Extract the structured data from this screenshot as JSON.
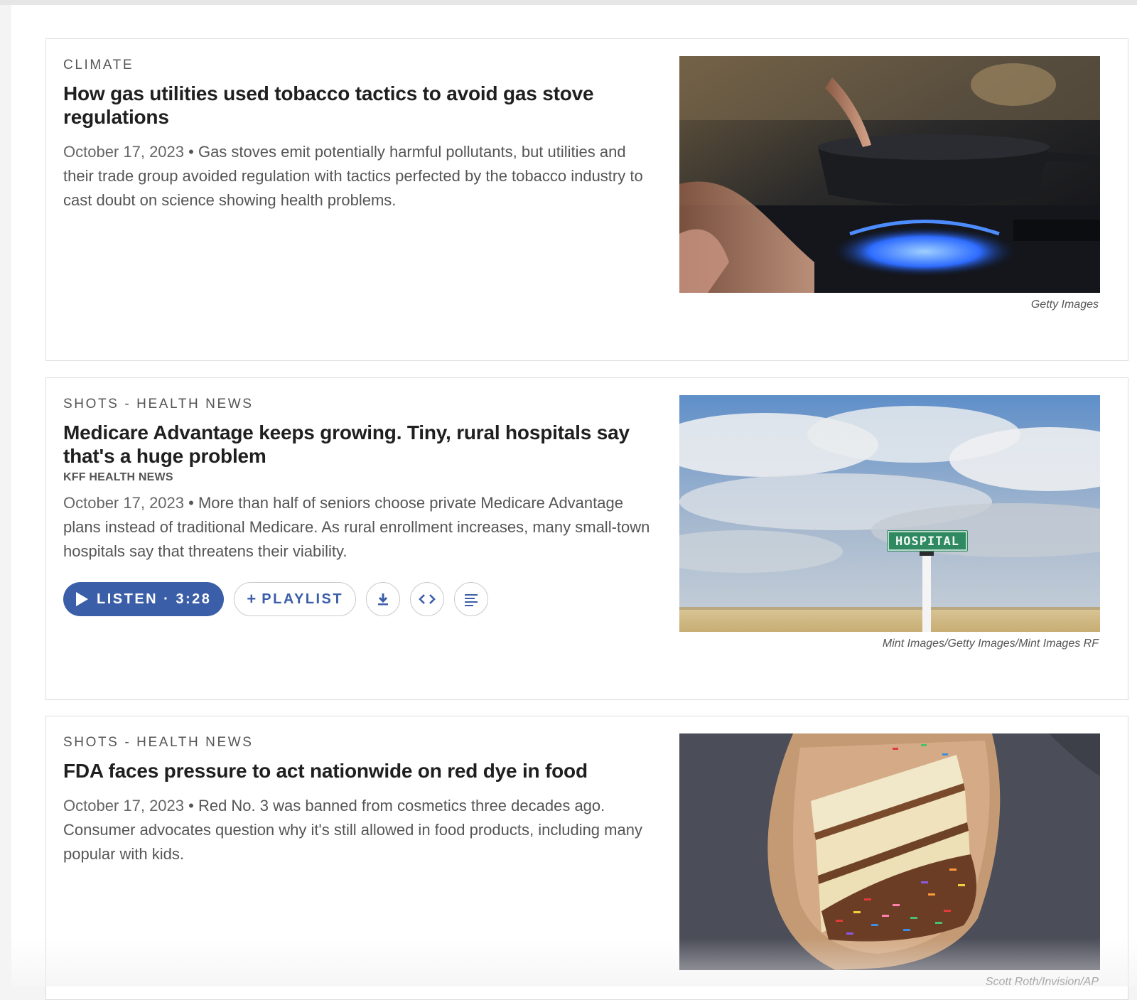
{
  "articles": [
    {
      "slug": "CLIMATE",
      "title": "How gas utilities used tobacco tactics to avoid gas stove regulations",
      "date": "October 17, 2023",
      "teaser": "Gas stoves emit potentially harmful pollutants, but utilities and their trade group avoided regulation with tactics perfected by the tobacco industry to cast doubt on science showing health problems.",
      "image_credit": "Getty Images"
    },
    {
      "slug": "SHOTS - HEALTH NEWS",
      "title": "Medicare Advantage keeps growing. Tiny, rural hospitals say that's a huge problem",
      "byline": "KFF HEALTH NEWS",
      "date": "October 17, 2023",
      "teaser": "More than half of seniors choose private Medicare Advantage plans instead of traditional Medicare. As rural enrollment increases, many small-town hospitals say that threatens their viability.",
      "audio": {
        "listen_label": "LISTEN · 3:28",
        "playlist_label": "PLAYLIST"
      },
      "sign_text": "HOSPITAL",
      "image_credit": "Mint Images/Getty Images/Mint Images RF"
    },
    {
      "slug": "SHOTS - HEALTH NEWS",
      "title": "FDA faces pressure to act nationwide on red dye in food",
      "date": "October 17, 2023",
      "teaser": "Red No. 3 was banned from cosmetics three decades ago. Consumer advocates question why it's still allowed in food products, including many popular with kids.",
      "image_credit": "Scott Roth/Invision/AP"
    }
  ],
  "icons": [
    "play-icon",
    "plus-icon",
    "download-icon",
    "embed-icon",
    "transcript-icon"
  ],
  "colors": {
    "accent": "#3b5ea8",
    "title": "#1f1f1f",
    "text": "#555555"
  }
}
